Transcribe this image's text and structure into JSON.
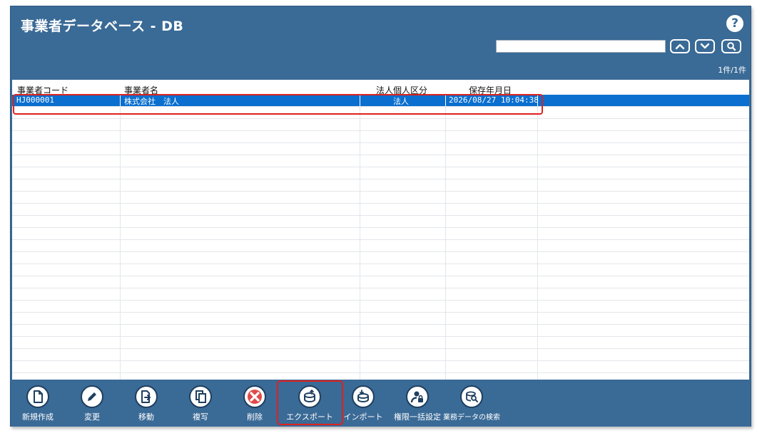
{
  "window": {
    "title": "事業者データベース - DB",
    "help_symbol": "?"
  },
  "search": {
    "value": "",
    "placeholder": ""
  },
  "count": "1件/1件",
  "table": {
    "columns": [
      "事業者コード",
      "事業者名",
      "法人個人区分",
      "保存年月日"
    ],
    "rows": [
      {
        "code": "HJ000001",
        "name": "株式会社　法人",
        "type": "法人",
        "saved": "2026/08/27 10:04:38"
      }
    ]
  },
  "toolbar": {
    "buttons": [
      {
        "label": "新規作成",
        "icon": "new-document-icon"
      },
      {
        "label": "変更",
        "icon": "pencil-icon"
      },
      {
        "label": "移動",
        "icon": "move-document-icon"
      },
      {
        "label": "複写",
        "icon": "copy-icon"
      },
      {
        "label": "削除",
        "icon": "delete-x-icon"
      },
      {
        "label": "エクスポート",
        "icon": "export-database-icon"
      },
      {
        "label": "インポート",
        "icon": "import-database-icon"
      },
      {
        "label": "権限一括設定",
        "icon": "user-lock-icon"
      },
      {
        "label": "業務データの検索",
        "icon": "database-search-icon"
      }
    ]
  },
  "colors": {
    "header_bg": "#3a6a96",
    "selected_row": "#0a6fcf",
    "highlight": "#e0201e"
  }
}
